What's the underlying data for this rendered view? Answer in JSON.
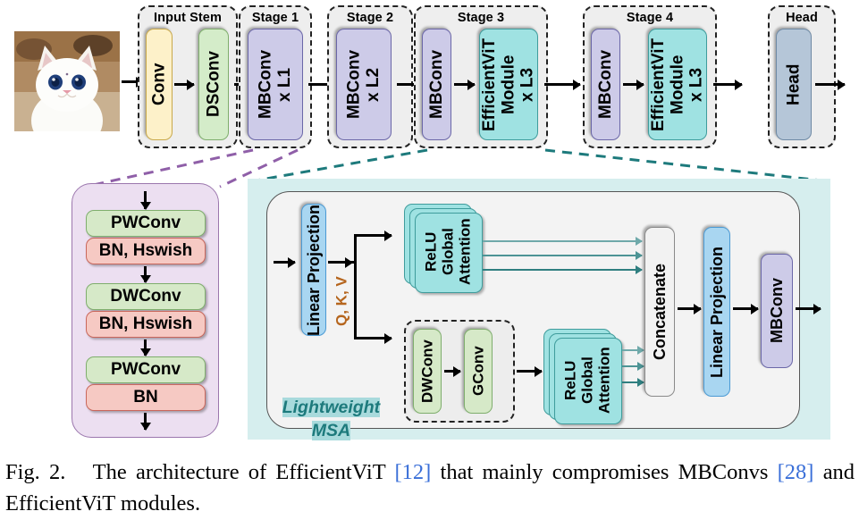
{
  "figure": {
    "caption_prefix": "Fig. 2.",
    "caption_part1": "The architecture of EfficientViT",
    "ref1": "[12]",
    "caption_part2": "that mainly compromises MBConvs",
    "ref2": "[28]",
    "caption_part3": "and EfficientViT modules."
  },
  "input": {
    "image_alt": "cat-photo"
  },
  "pipeline": {
    "groups": [
      {
        "label": "Input Stem",
        "blocks": [
          {
            "text": "Conv"
          },
          {
            "text": "DSConv"
          }
        ]
      },
      {
        "label": "Stage 1",
        "blocks": [
          {
            "text": "MBConv\nx L1"
          }
        ]
      },
      {
        "label": "Stage 2",
        "blocks": [
          {
            "text": "MBConv\nx L2"
          }
        ]
      },
      {
        "label": "Stage 3",
        "blocks": [
          {
            "text": "MBConv"
          },
          {
            "text": "EfficientViT\nModule\nx L3"
          }
        ]
      },
      {
        "label": "Stage 4",
        "blocks": [
          {
            "text": "MBConv"
          },
          {
            "text": "EfficientViT\nModule\nx L3"
          }
        ]
      },
      {
        "label": "Head",
        "blocks": [
          {
            "text": "Head"
          }
        ]
      }
    ]
  },
  "mbconv_detail": {
    "blocks": [
      {
        "text": "PWConv",
        "kind": "conv"
      },
      {
        "text": "BN, Hswish",
        "kind": "norm"
      },
      {
        "text": "DWConv",
        "kind": "conv"
      },
      {
        "text": "BN, Hswish",
        "kind": "norm"
      },
      {
        "text": "PWConv",
        "kind": "conv"
      },
      {
        "text": "BN",
        "kind": "norm"
      }
    ]
  },
  "efficientvit_detail": {
    "linear_projection_in": "Linear Projection",
    "qkv_label": "Q, K, V",
    "msa_line1": "Lightweight",
    "msa_line2": "MSA",
    "attention_top": "ReLU\nGlobal\nAttention",
    "attention_bottom": "ReLU\nGlobal\nAttention",
    "dwconv": "DWConv",
    "gconv": "GConv",
    "concatenate": "Concatenate",
    "linear_projection_out": "Linear Projection",
    "mbconv": "MBConv"
  },
  "colors": {
    "conv_yellow": "#fdf1c9",
    "dsconv_green": "#d4ecc9",
    "mbconv_purple": "#cdcbe8",
    "evit_cyan": "#9fe2e2",
    "head_blue": "#b5c6d8",
    "linear_blue": "#a9d6f1",
    "norm_red": "#f6c9c3",
    "panel_purple": "#ecdff1",
    "panel_teal": "#d6eeee",
    "qkv_orange": "#b5651d",
    "msa_teal": "#1d7a7c",
    "ref_blue": "#3a6fd8"
  }
}
